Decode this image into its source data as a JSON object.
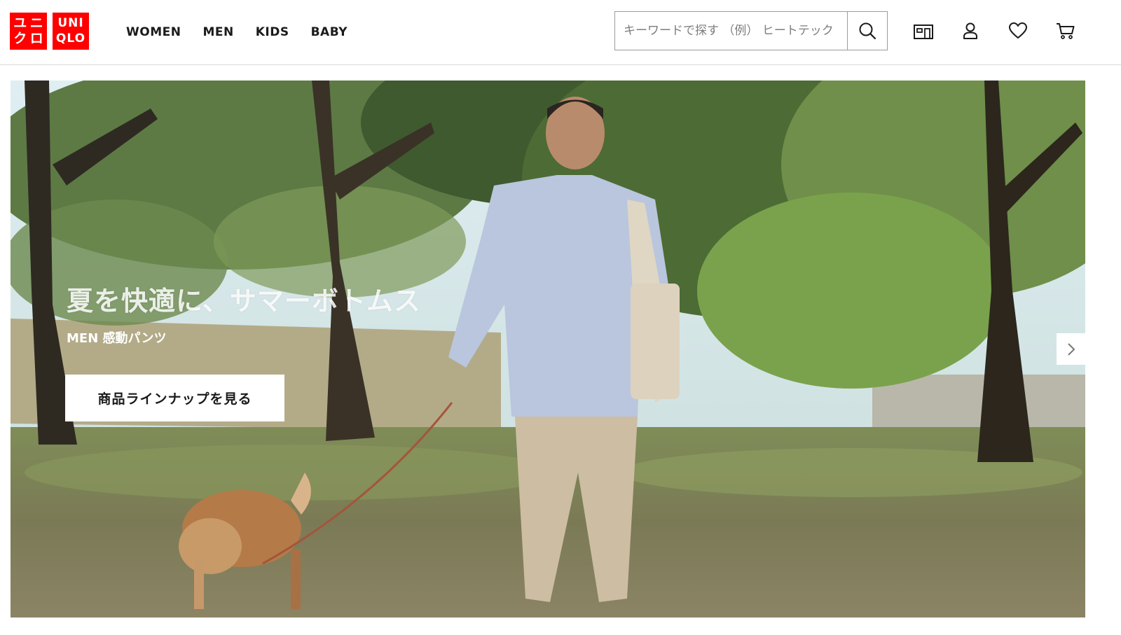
{
  "logo": {
    "left_chars": [
      "ユ",
      "ニ",
      "ク",
      "ロ"
    ],
    "right_lines": [
      "UNI",
      "QLO"
    ],
    "brand_color": "#ff0000"
  },
  "nav": {
    "items": [
      {
        "label": "WOMEN"
      },
      {
        "label": "MEN"
      },
      {
        "label": "KIDS"
      },
      {
        "label": "BABY"
      }
    ]
  },
  "search": {
    "placeholder": "キーワードで探す （例） ヒートテック",
    "icon": "search-icon"
  },
  "header_icons": [
    "store-icon",
    "user-icon",
    "heart-icon",
    "cart-icon"
  ],
  "hero": {
    "title": "夏を快適に、サマーボトムス",
    "subtitle": "MEN 感動パンツ",
    "cta_label": "商品ラインナップを見る",
    "next_icon": "chevron-right-icon"
  }
}
